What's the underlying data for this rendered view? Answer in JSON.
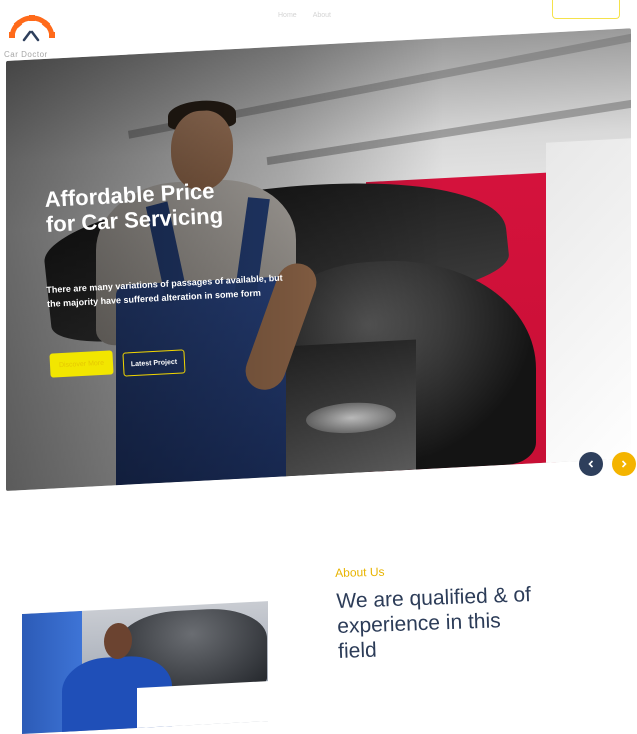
{
  "header": {
    "logo": {
      "text": "Car Doctor",
      "icon": "gear-wrench-logo-icon",
      "color": "#ff6a1a"
    },
    "nav": [
      "Home",
      "About"
    ],
    "cta_label": ""
  },
  "hero": {
    "title": "Affordable Price for Car Servicing",
    "description": "There are many variations of passages of available, but the majority have suffered alteration in some form",
    "primary_button": "Discover More",
    "secondary_button": "Latest Project",
    "prev_icon": "chevron-left-icon",
    "next_icon": "chevron-right-icon",
    "accent": "#f2e600",
    "prev_color": "#2e3f5c",
    "next_color": "#f4b400"
  },
  "about": {
    "eyebrow": "About Us",
    "title": "We are qualified & of experience in this field",
    "eyebrow_color": "#e8b400",
    "title_color": "#2c3c58"
  }
}
